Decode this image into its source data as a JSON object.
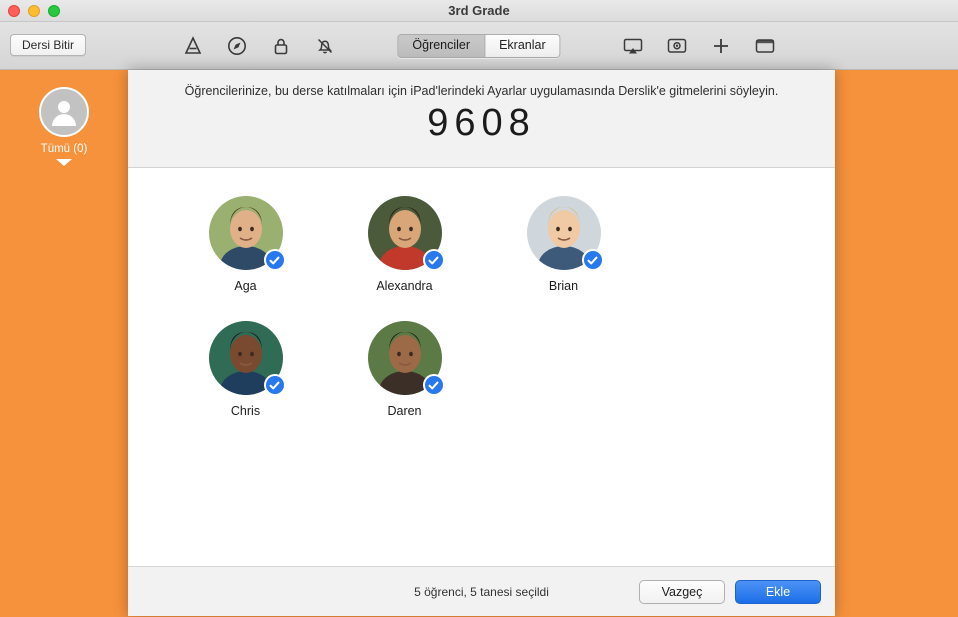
{
  "window": {
    "title": "3rd Grade",
    "traffic_lights": [
      "close-button",
      "minimize-button",
      "zoom-button"
    ]
  },
  "toolbar": {
    "end_class_label": "Dersi Bitir",
    "left_icons": [
      {
        "name": "apps-icon",
        "glyph": "A"
      },
      {
        "name": "navigate-icon",
        "glyph": "compass"
      },
      {
        "name": "lock-icon",
        "glyph": "lock"
      },
      {
        "name": "mute-icon",
        "glyph": "bell-slash"
      }
    ],
    "segmented": {
      "items": [
        {
          "label": "Öğrenciler",
          "active": true
        },
        {
          "label": "Ekranlar",
          "active": false
        }
      ]
    },
    "right_icons": [
      {
        "name": "airplay-icon",
        "glyph": "screen"
      },
      {
        "name": "screen-view-icon",
        "glyph": "eye-screen"
      },
      {
        "name": "add-icon",
        "glyph": "+"
      },
      {
        "name": "open-screen-icon",
        "glyph": "window"
      }
    ]
  },
  "sidebar": {
    "items": [
      {
        "label": "Tümü (0)",
        "name": "sidebar-item-all",
        "selected": true
      }
    ]
  },
  "sheet": {
    "instruction": "Öğrencilerinize, bu derse katılmaları için iPad'lerindeki Ayarlar uygulamasında Derslik'e gitmelerini söyleyin.",
    "code": "9608",
    "students": [
      {
        "name": "Aga",
        "selected": true,
        "hair": "#5a3a20",
        "skin": "#e0b089",
        "shirt": "#2f4a66",
        "bg": "#9ab070"
      },
      {
        "name": "Alexandra",
        "selected": true,
        "hair": "#2a1a12",
        "skin": "#d8a678",
        "shirt": "#c0392b",
        "bg": "#4a5a3a"
      },
      {
        "name": "Brian",
        "selected": true,
        "hair": "#d9c189",
        "skin": "#f0c9a5",
        "shirt": "#3d5a7a",
        "bg": "#cfd6dc"
      },
      {
        "name": "Chris",
        "selected": true,
        "hair": "#1b1210",
        "skin": "#7a4a30",
        "shirt": "#1f3d5c",
        "bg": "#2f6b55"
      },
      {
        "name": "Daren",
        "selected": true,
        "hair": "#221814",
        "skin": "#9c6a46",
        "shirt": "#3b2f28",
        "bg": "#5c7a45"
      }
    ],
    "footer": {
      "status": "5 öğrenci, 5 tanesi seçildi",
      "cancel_label": "Vazgeç",
      "add_label": "Ekle"
    }
  },
  "colors": {
    "accent_orange": "#f6923c",
    "selection_blue": "#2878f0",
    "primary_button": "#1b6ee8"
  }
}
